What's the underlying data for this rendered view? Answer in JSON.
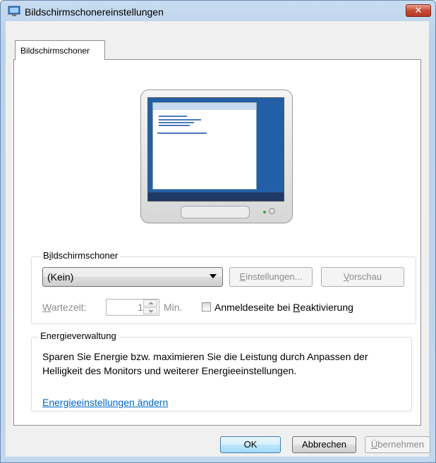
{
  "window": {
    "title": "Bildschirmschonereinstellungen",
    "close_symbol": "✕"
  },
  "tabs": [
    {
      "label": "Bildschirmschoner"
    }
  ],
  "screensaver_group": {
    "label_pre": "B",
    "label_acc": "i",
    "label_post": "ldschirmschoner",
    "selected": "(Kein)",
    "settings_button": {
      "acc": "E",
      "rest": "instellungen..."
    },
    "preview_button": {
      "acc": "V",
      "rest": "orschau"
    },
    "wait_label": {
      "acc": "W",
      "rest": "artezeit:"
    },
    "wait_value": "1",
    "wait_unit": "Min.",
    "checkbox_label": {
      "pre": "Anmeldeseite bei ",
      "acc": "R",
      "post": "eaktivierung"
    },
    "checkbox_checked": false
  },
  "energy_group": {
    "label": "Energieverwaltung",
    "text": "Sparen Sie Energie bzw. maximieren Sie die Leistung durch Anpassen der Helligkeit des Monitors und weiterer Energieeinstellungen.",
    "link": "Energieeinstellungen ändern"
  },
  "footer": {
    "ok": "OK",
    "cancel": "Abbrechen",
    "apply": {
      "acc": "Ü",
      "rest": "bernehmen"
    }
  }
}
